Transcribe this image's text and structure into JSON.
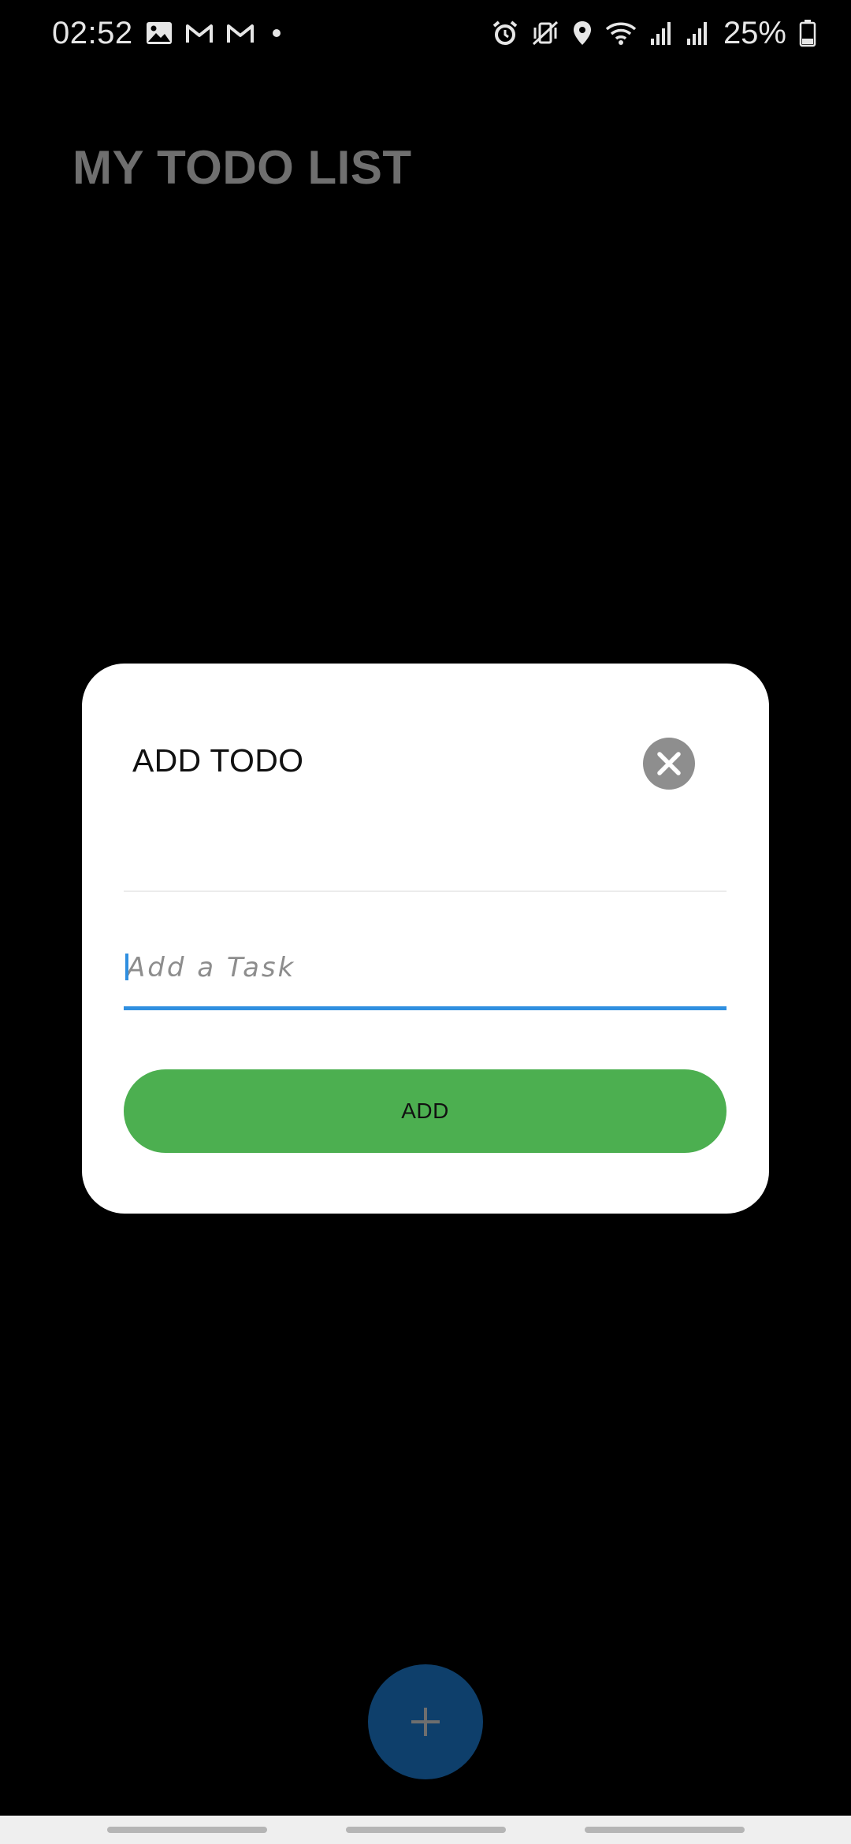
{
  "status_bar": {
    "time": "02:52",
    "battery_percent": "25%",
    "icons": [
      "image-icon",
      "gmail-icon",
      "gmail-icon",
      "dot-icon",
      "alarm-icon",
      "vibrate-icon",
      "location-icon",
      "wifi-icon",
      "signal-icon",
      "signal-icon",
      "battery-icon"
    ]
  },
  "app": {
    "title": "MY TODO LIST"
  },
  "dialog": {
    "title": "ADD TODO",
    "close_icon": "close-icon",
    "input": {
      "value": "",
      "placeholder": "Add a Task"
    },
    "add_label": "ADD"
  },
  "fab": {
    "icon": "plus-icon"
  },
  "colors": {
    "background": "#000000",
    "title_gray": "#6f6f6f",
    "dialog_bg": "#ffffff",
    "accent_blue": "#2f8fe0",
    "add_green": "#4caf50",
    "fab_blue": "#0e3f6b",
    "close_gray": "#8e8e8e"
  }
}
